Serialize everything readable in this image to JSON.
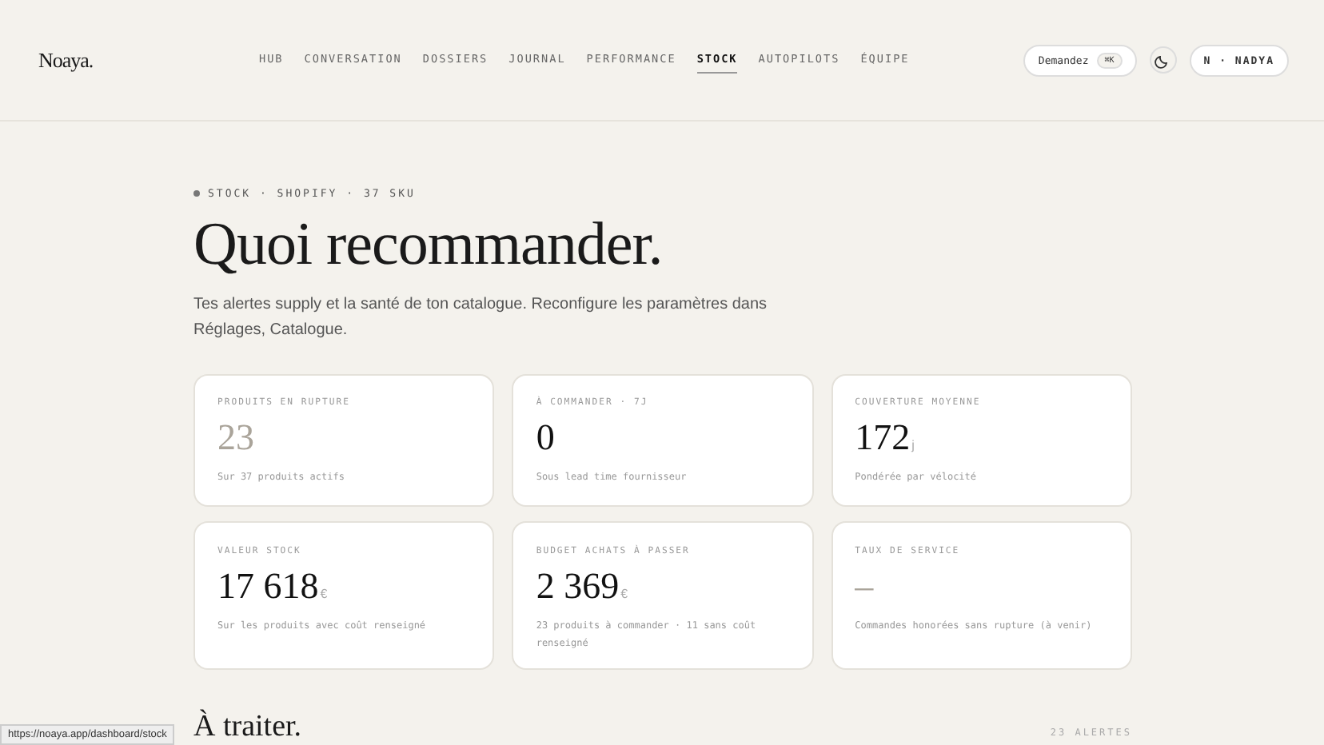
{
  "header": {
    "logo": "Noaya.",
    "nav": [
      {
        "label": "HUB",
        "selected": false
      },
      {
        "label": "CONVERSATION",
        "selected": false
      },
      {
        "label": "DOSSIERS",
        "selected": false
      },
      {
        "label": "JOURNAL",
        "selected": false
      },
      {
        "label": "PERFORMANCE",
        "selected": false
      },
      {
        "label": "STOCK",
        "selected": true
      },
      {
        "label": "AUTOPILOTS",
        "selected": false
      },
      {
        "label": "ÉQUIPE",
        "selected": false
      }
    ],
    "ask_button": {
      "label": "Demandez",
      "shortcut": "⌘K"
    },
    "user_button": "N · NADYA"
  },
  "page": {
    "eyebrow": "STOCK · SHOPIFY · 37 SKU",
    "title": "Quoi recommander.",
    "intro": "Tes alertes supply et la santé de ton catalogue. Reconfigure les paramètres dans Réglages, Catalogue.",
    "stats": [
      {
        "label": "PRODUITS EN RUPTURE",
        "value": "23",
        "kind": "muted",
        "note": "Sur 37 produits actifs"
      },
      {
        "label": "À COMMANDER · 7J",
        "value": "0",
        "kind": "normal",
        "note": "Sous lead time fournisseur"
      },
      {
        "label": "COUVERTURE MOYENNE",
        "value": "172",
        "unit": "j",
        "kind": "normal",
        "note": "Pondérée par vélocité"
      },
      {
        "label": "VALEUR STOCK",
        "value": "17 618",
        "unit": "€",
        "kind": "normal",
        "note": "Sur les produits avec coût renseigné"
      },
      {
        "label": "BUDGET ACHATS À PASSER",
        "value": "2 369",
        "unit": "€",
        "kind": "normal",
        "note": "23 produits à commander · 11 sans coût renseigné"
      },
      {
        "label": "TAUX DE SERVICE",
        "value": "–",
        "kind": "muted",
        "note": "Commandes honorées sans rupture (à venir)"
      }
    ],
    "section_title": "À traiter.",
    "section_count": "23 ALERTES"
  },
  "status_bar": {
    "url": "https://noaya.app/dashboard/stock"
  }
}
